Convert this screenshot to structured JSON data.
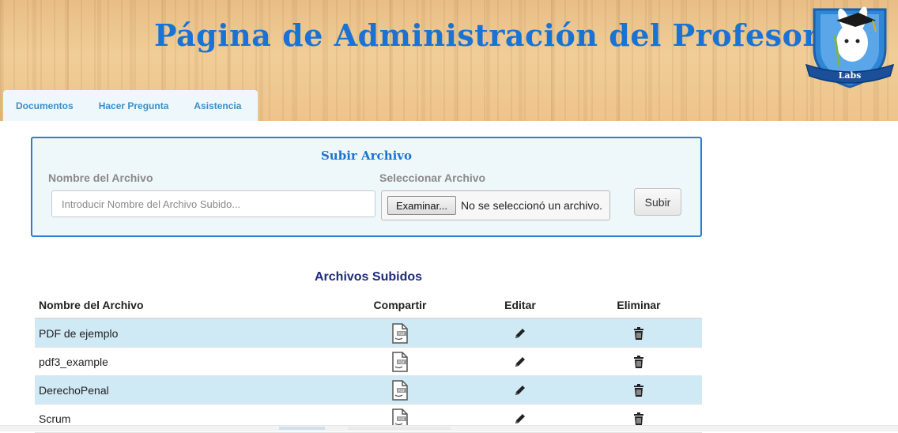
{
  "header": {
    "title": "Página de Administración del Profesor",
    "logo_text": "Labs"
  },
  "tabs": [
    {
      "label": "Documentos"
    },
    {
      "label": "Hacer Pregunta"
    },
    {
      "label": "Asistencia"
    }
  ],
  "upload": {
    "title": "Subir Archivo",
    "name_label": "Nombre del Archivo",
    "name_placeholder": "Introducir Nombre del Archivo Subido...",
    "file_label": "Seleccionar Archivo",
    "browse_label": "Examinar...",
    "no_file_text": "No se seleccionó un archivo.",
    "submit_label": "Subir"
  },
  "files": {
    "title": "Archivos Subidos",
    "columns": {
      "name": "Nombre del Archivo",
      "share": "Compartir",
      "edit": "Editar",
      "delete": "Eliminar"
    },
    "rows": [
      {
        "name": "PDF de ejemplo"
      },
      {
        "name": "pdf3_example"
      },
      {
        "name": "DerechoPenal"
      },
      {
        "name": "Scrum"
      }
    ]
  },
  "colors": {
    "accent": "#1a73d4",
    "tab_text": "#3a8fc7",
    "row_alt": "#cfe9f5"
  }
}
